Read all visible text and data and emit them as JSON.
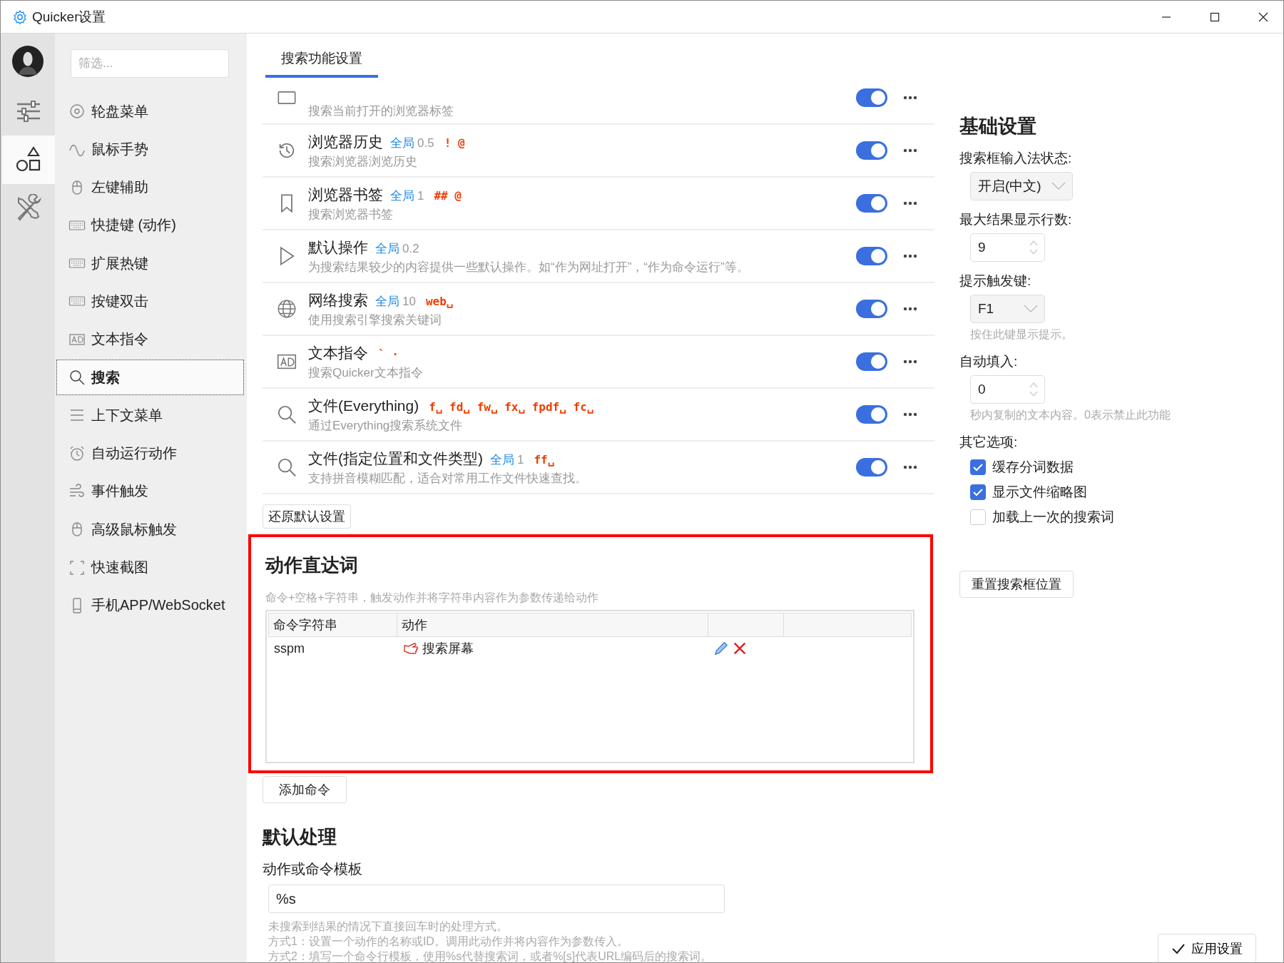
{
  "window": {
    "title": "Quicker设置"
  },
  "rail": [
    {
      "selected": false
    },
    {
      "selected": true
    },
    {
      "selected": false
    }
  ],
  "sidebar": {
    "filter_placeholder": "筛选...",
    "items": [
      {
        "label": "轮盘菜单",
        "selected": false
      },
      {
        "label": "鼠标手势",
        "selected": false
      },
      {
        "label": "左键辅助",
        "selected": false
      },
      {
        "label": "快捷键 (动作)",
        "selected": false
      },
      {
        "label": "扩展热键",
        "selected": false
      },
      {
        "label": "按键双击",
        "selected": false
      },
      {
        "label": "文本指令",
        "selected": false
      },
      {
        "label": "搜索",
        "selected": true
      },
      {
        "label": "上下文菜单",
        "selected": false
      },
      {
        "label": "自动运行动作",
        "selected": false
      },
      {
        "label": "事件触发",
        "selected": false
      },
      {
        "label": "高级鼠标触发",
        "selected": false
      },
      {
        "label": "快速截图",
        "selected": false
      },
      {
        "label": "手机APP/WebSocket",
        "selected": false
      }
    ]
  },
  "tabs": [
    {
      "label": "搜索功能设置",
      "selected": true
    }
  ],
  "search_modules": [
    {
      "description": "搜索当前打开的浏览器标签",
      "enabled": true
    },
    {
      "title": "浏览器历史",
      "scope": "全局",
      "weight": "0.5",
      "keywords": "! @",
      "description": "搜索浏览器浏览历史",
      "enabled": true
    },
    {
      "title": "浏览器书签",
      "scope": "全局",
      "weight": "1",
      "keywords": "## @",
      "description": "搜索浏览器书签",
      "enabled": true
    },
    {
      "title": "默认操作",
      "scope": "全局",
      "weight": "0.2",
      "description": "为搜索结果较少的内容提供一些默认操作。如“作为网址打开”，“作为命令运行”等。",
      "enabled": true
    },
    {
      "title": "网络搜索",
      "scope": "全局",
      "weight": "10",
      "keywords": "web␣",
      "description": "使用搜索引擎搜索关键词",
      "enabled": true
    },
    {
      "title": "文本指令",
      "keywords": "` ·",
      "description": "搜索Quicker文本指令",
      "enabled": true
    },
    {
      "title": "文件(Everything)",
      "keywords": "f␣ fd␣ fw␣ fx␣ fpdf␣ fc␣",
      "description": "通过Everything搜索系统文件",
      "enabled": true
    },
    {
      "title": "文件(指定位置和文件类型)",
      "scope": "全局",
      "weight": "1",
      "keywords": "ff␣",
      "description": "支持拼音模糊匹配，适合对常用工作文件快速查找。",
      "enabled": true
    }
  ],
  "reset_button": "还原默认设置",
  "action_keywords": {
    "highlighted": true,
    "title": "动作直达词",
    "hint": "命令+空格+字符串，触发动作并将字符串内容作为参数传递给动作",
    "columns": [
      "命令字符串",
      "动作"
    ],
    "rows": [
      {
        "command": "sspm",
        "action": "搜索屏幕"
      }
    ],
    "add_button": "添加命令"
  },
  "default_handling": {
    "title": "默认处理",
    "label": "动作或命令模板",
    "value": "%s",
    "help": [
      "未搜索到结果的情况下直接回车时的处理方式。",
      "方式1：设置一个动作的名称或ID。调用此动作并将内容作为参数传入。",
      "方式2：填写一个命令行模板，使用%s代替搜索词，或者%[s]代表URL编码后的搜索词。"
    ]
  },
  "basic_settings": {
    "title": "基础设置",
    "fields": [
      {
        "kind": "select",
        "label": "搜索框输入法状态:",
        "value": "开启(中文)"
      },
      {
        "kind": "number",
        "label": "最大结果显示行数:",
        "value": "9"
      },
      {
        "kind": "select",
        "label": "提示触发键:",
        "value": "F1",
        "hint": "按住此键显示提示。"
      },
      {
        "kind": "number",
        "label": "自动填入:",
        "value": "0",
        "hint": "秒内复制的文本内容。0表示禁止此功能"
      }
    ],
    "options_label": "其它选项:",
    "options": [
      {
        "label": "缓存分词数据",
        "checked": true
      },
      {
        "label": "显示文件缩略图",
        "checked": true
      },
      {
        "label": "加载上一次的搜索词",
        "checked": false
      }
    ],
    "reset_position_button": "重置搜索框位置"
  },
  "apply_button": "应用设置"
}
